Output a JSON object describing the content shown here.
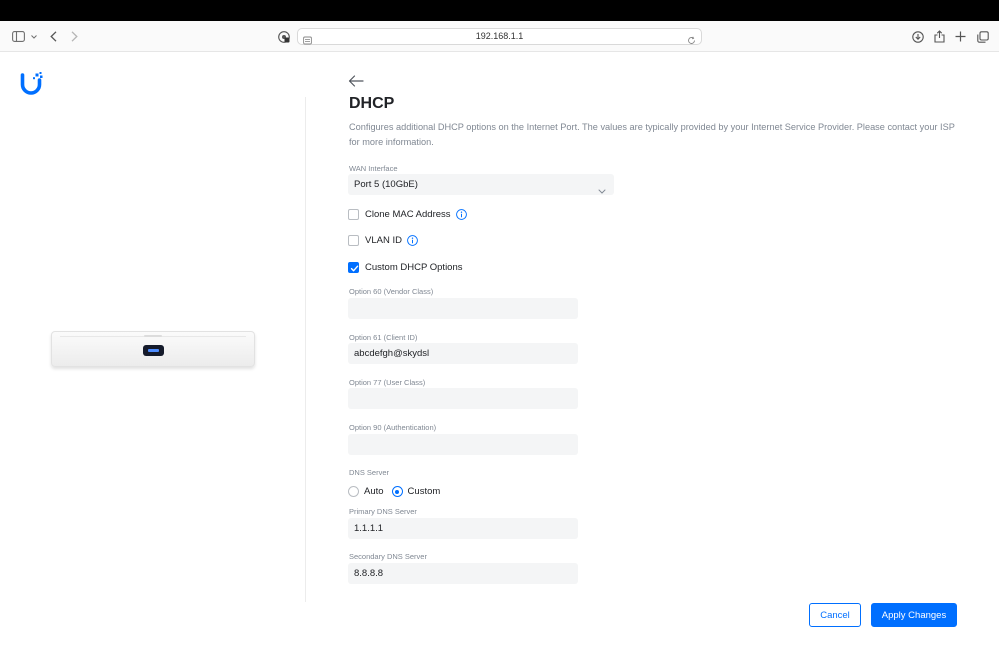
{
  "browser": {
    "url": "192.168.1.1"
  },
  "page": {
    "title": "DHCP",
    "description": "Configures additional DHCP options on the Internet Port. The values are typically provided by your Internet Service Provider. Please contact your ISP for more information."
  },
  "wan": {
    "label": "WAN Interface",
    "value": "Port 5 (10GbE)"
  },
  "checkboxes": {
    "clone_mac": {
      "label": "Clone MAC Address",
      "checked": false
    },
    "vlan_id": {
      "label": "VLAN ID",
      "checked": false
    },
    "custom_dhcp": {
      "label": "Custom DHCP Options",
      "checked": true
    }
  },
  "options": {
    "opt60": {
      "label": "Option 60 (Vendor Class)",
      "value": ""
    },
    "opt61": {
      "label": "Option 61 (Client ID)",
      "value": "abcdefgh@skydsl"
    },
    "opt77": {
      "label": "Option 77 (User Class)",
      "value": ""
    },
    "opt90": {
      "label": "Option 90 (Authentication)",
      "value": ""
    }
  },
  "dns": {
    "label": "DNS Server",
    "auto_label": "Auto",
    "custom_label": "Custom",
    "selected": "Custom",
    "primary_label": "Primary DNS Server",
    "primary_value": "1.1.1.1",
    "secondary_label": "Secondary DNS Server",
    "secondary_value": "8.8.8.8"
  },
  "actions": {
    "cancel": "Cancel",
    "apply": "Apply Changes"
  },
  "colors": {
    "accent": "#006fff",
    "text": "#212327",
    "muted": "#808893",
    "input_bg": "#f4f5f6"
  }
}
